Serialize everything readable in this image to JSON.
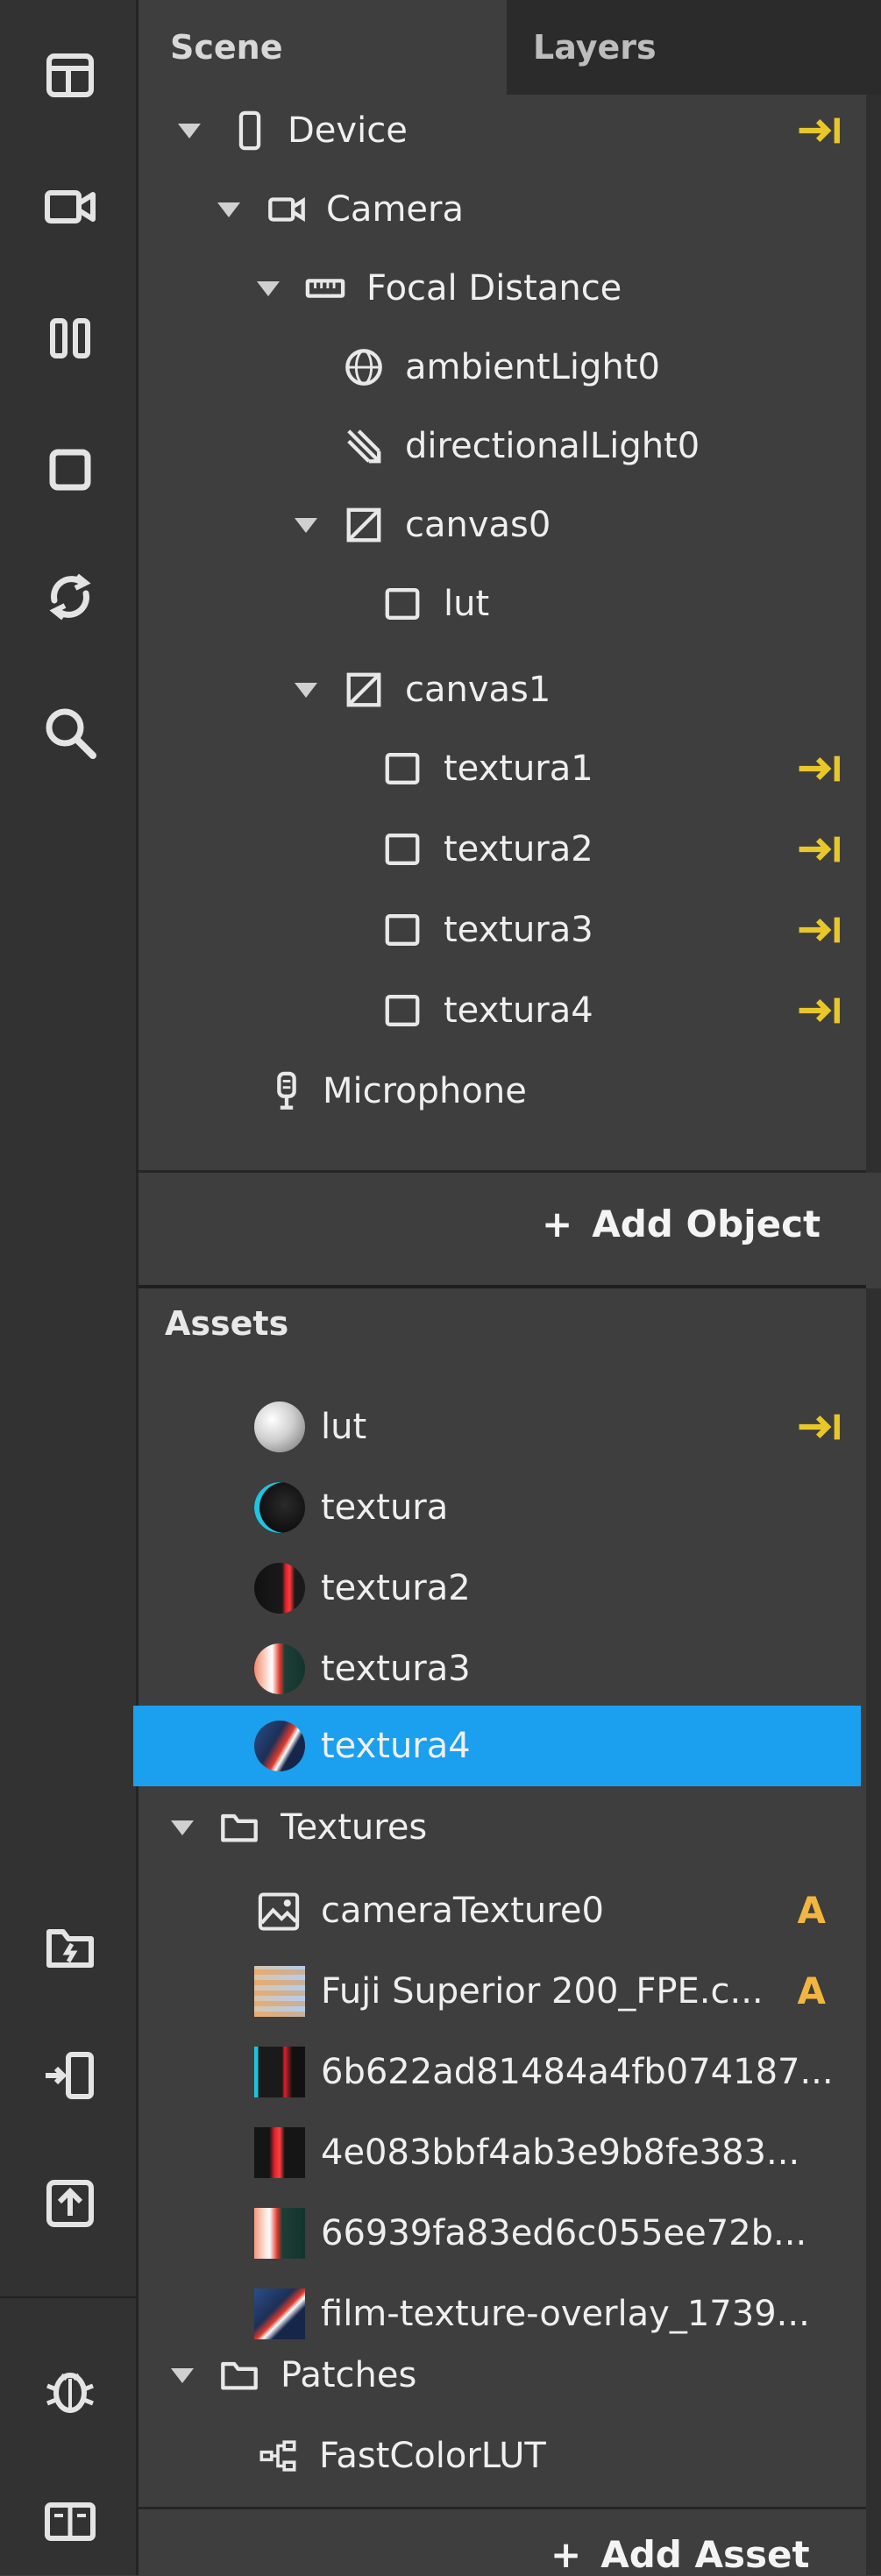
{
  "toolbar": {
    "top_buttons": [
      "layout-icon",
      "video-camera-icon",
      "pause-icon",
      "stop-icon",
      "refresh-icon",
      "search-icon"
    ],
    "bottom_buttons": [
      "new-folder-icon",
      "send-to-device-icon",
      "upload-icon",
      "bug-icon",
      "docs-icon"
    ]
  },
  "tabs": {
    "scene": "Scene",
    "layers": "Layers"
  },
  "scene_tree": {
    "device": "Device",
    "camera": "Camera",
    "focal_distance": "Focal Distance",
    "ambient_light": "ambientLight0",
    "directional_light": "directionalLight0",
    "canvas0": "canvas0",
    "lut": "lut",
    "canvas1": "canvas1",
    "textura1": "textura1",
    "textura2": "textura2",
    "textura3": "textura3",
    "textura4": "textura4",
    "microphone": "Microphone"
  },
  "add_object_label": "Add Object",
  "assets": {
    "title": "Assets",
    "materials": [
      "lut",
      "textura",
      "textura2",
      "textura3",
      "textura4"
    ],
    "selected_material": "textura4",
    "textures_folder": "Textures",
    "textures": [
      "cameraTexture0",
      "Fuji Superior 200_FPE.c...",
      "6b622ad81484a4fb074187...",
      "4e083bbf4ab3e9b8fe383...",
      "66939fa83ed6c055ee72b...",
      "film-texture-overlay_1739..."
    ],
    "warning_glyph": "A",
    "patches_folder": "Patches",
    "patch_item": "FastColorLUT"
  },
  "add_asset_label": "Add Asset",
  "colors": {
    "selection": "#1aa0ee",
    "pin": "#e8c72a",
    "warning": "#f2b640",
    "panel": "#3e3e3e",
    "toolbar": "#323232"
  }
}
